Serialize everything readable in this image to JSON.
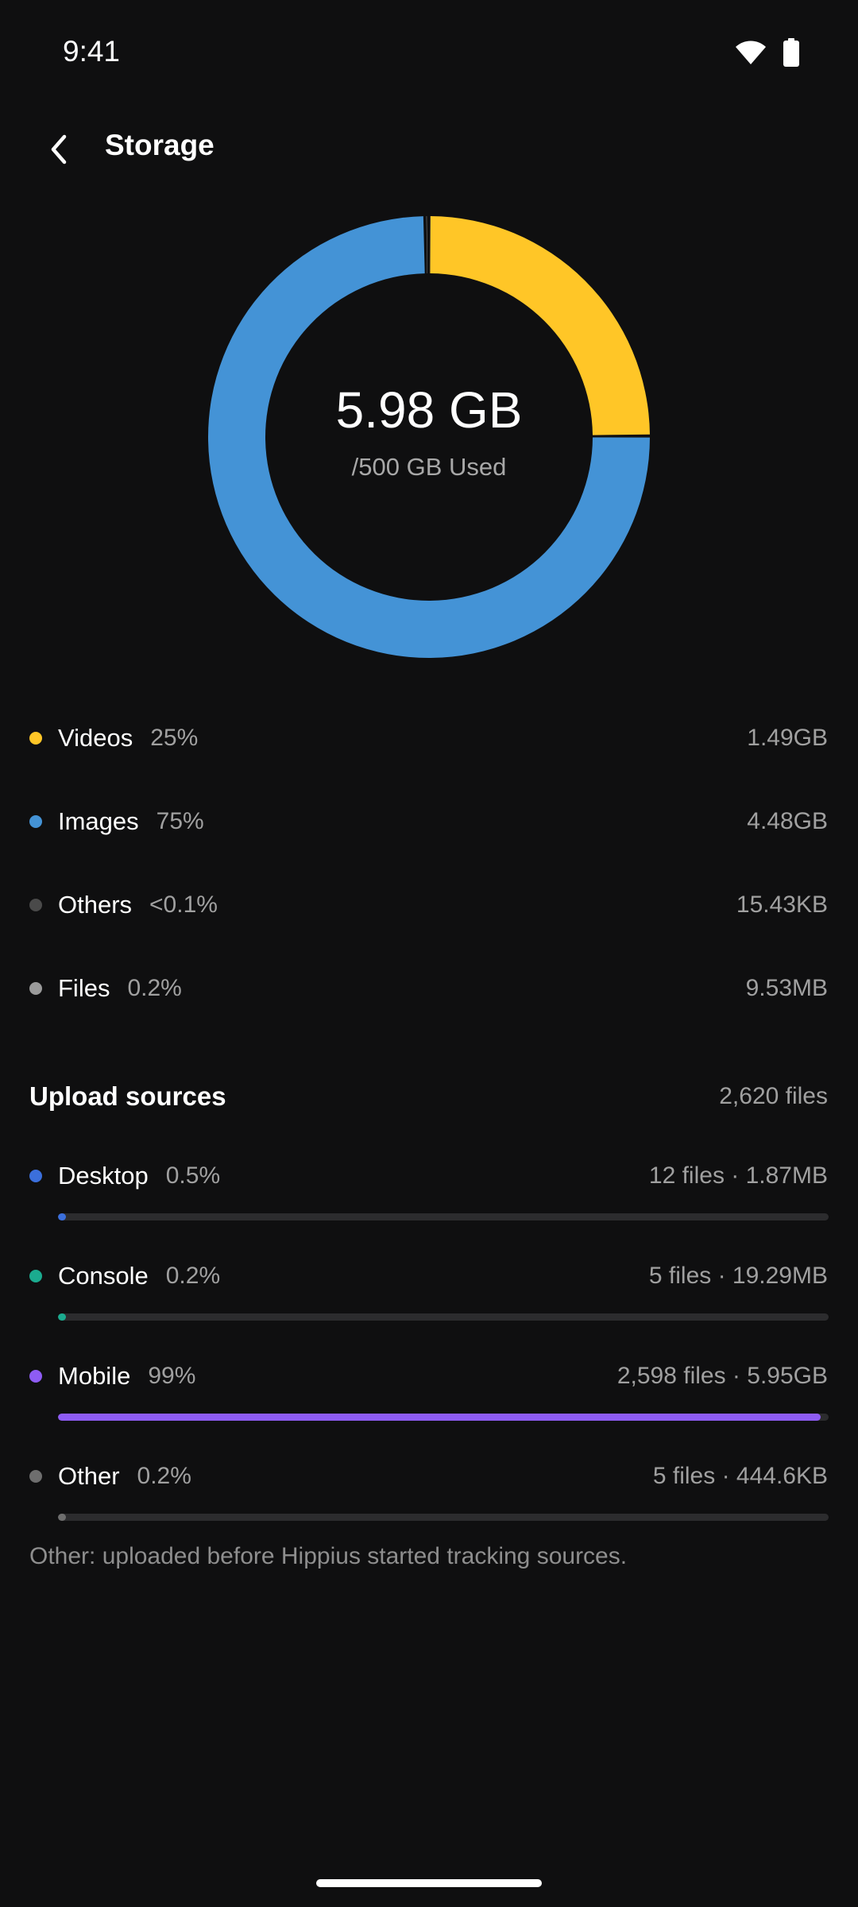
{
  "status": {
    "time": "9:41",
    "wifi_icon": "wifi-icon",
    "battery_icon": "battery-icon"
  },
  "header": {
    "back_icon": "chevron-left-icon",
    "title": "Storage"
  },
  "usage": {
    "used": "5.98 GB",
    "total_label": "/500 GB Used"
  },
  "chart_data": {
    "type": "pie",
    "donut": true,
    "categories": [
      "Videos",
      "Images",
      "Others",
      "Files"
    ],
    "values": [
      25,
      75,
      0.1,
      0.2
    ],
    "colors": [
      "#ffc627",
      "#4493d6",
      "#4a4a4a",
      "#9a9a9a"
    ]
  },
  "categories": [
    {
      "name": "Videos",
      "percent": "25%",
      "size": "1.49GB",
      "color": "#ffc627"
    },
    {
      "name": "Images",
      "percent": "75%",
      "size": "4.48GB",
      "color": "#4493d6"
    },
    {
      "name": "Others",
      "percent": "<0.1%",
      "size": "15.43KB",
      "color": "#4a4a4a"
    },
    {
      "name": "Files",
      "percent": "0.2%",
      "size": "9.53MB",
      "color": "#9a9a9a"
    }
  ],
  "upload_sources": {
    "title": "Upload sources",
    "total": "2,620 files",
    "items": [
      {
        "name": "Desktop",
        "percent": "0.5%",
        "detail": "12 files · 1.87MB",
        "fraction": 0.005,
        "color": "#3b6fdc"
      },
      {
        "name": "Console",
        "percent": "0.2%",
        "detail": "5 files · 19.29MB",
        "fraction": 0.002,
        "color": "#1bab8f"
      },
      {
        "name": "Mobile",
        "percent": "99%",
        "detail": "2,598 files · 5.95GB",
        "fraction": 0.99,
        "color": "#8e5cf4"
      },
      {
        "name": "Other",
        "percent": "0.2%",
        "detail": "5 files · 444.6KB",
        "fraction": 0.002,
        "color": "#6e6e6e"
      }
    ],
    "footnote": "Other: uploaded before Hippius started tracking sources."
  }
}
